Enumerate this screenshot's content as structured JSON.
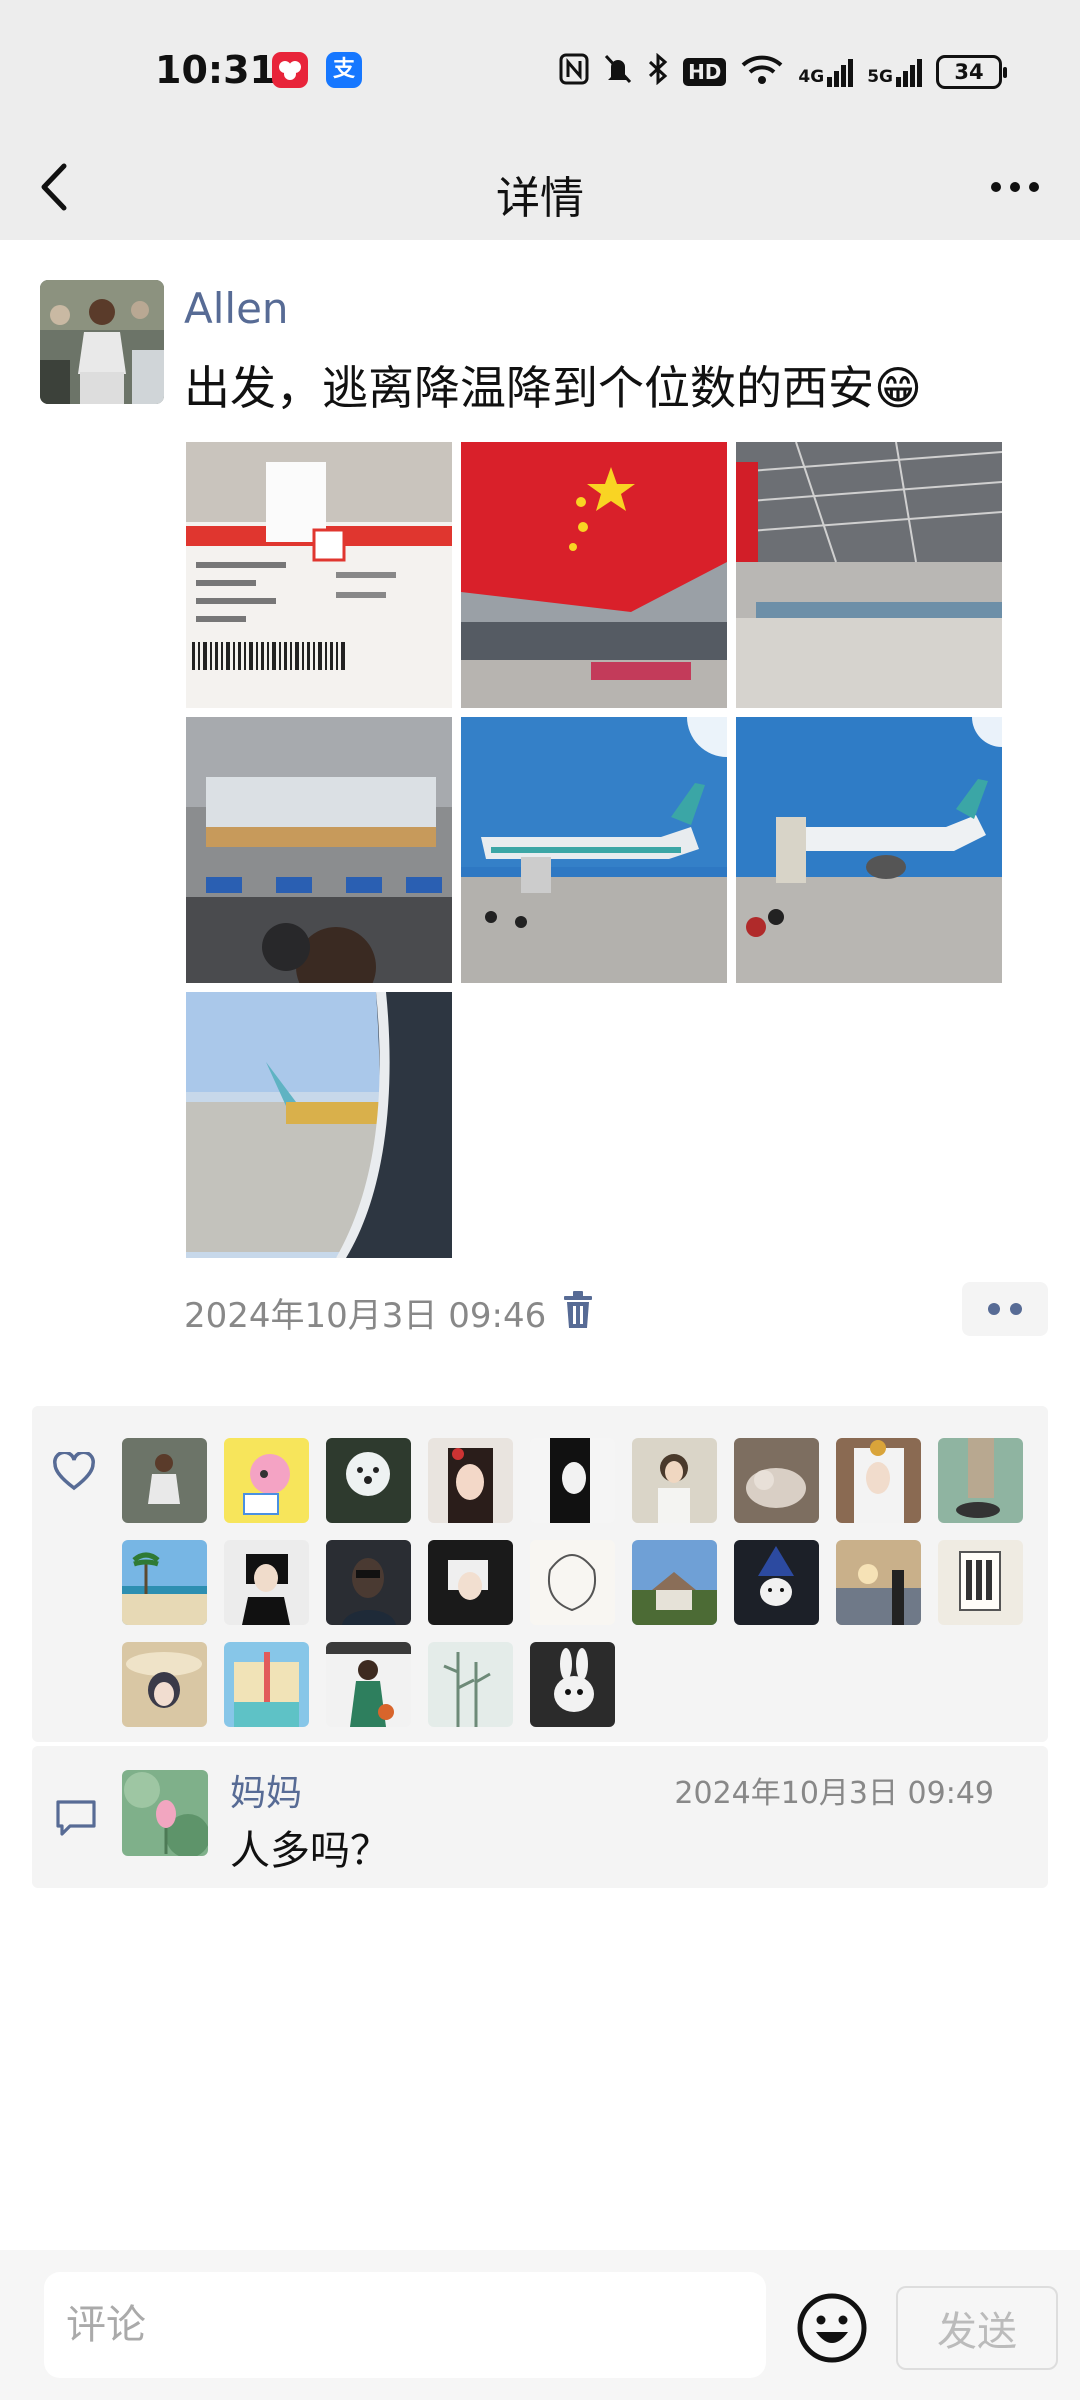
{
  "status_bar": {
    "time": "10:31",
    "apps": [
      {
        "icon": "hearts-app-icon",
        "color": "#e8243a"
      },
      {
        "icon": "alipay-app-icon",
        "color": "#1677ff",
        "glyph": "支"
      }
    ],
    "indicators": [
      "nfc-icon",
      "mute-icon",
      "bluetooth-icon",
      "hd-icon",
      "wifi-icon",
      "4g-signal-icon",
      "5g-signal-icon"
    ],
    "hd_label": "HD",
    "net_4g": "4G",
    "net_5g": "5G",
    "battery": "34"
  },
  "nav": {
    "title": "详情"
  },
  "post": {
    "author": "Allen",
    "text": "出发，逃离降温降到个位数的西安😁",
    "timestamp": "2024年10月3日 09:46",
    "photos": [
      {
        "subject": "boarding-pass-photo"
      },
      {
        "subject": "flag-terminal-photo"
      },
      {
        "subject": "terminal-hall-photo"
      },
      {
        "subject": "check-in-hall-photo"
      },
      {
        "subject": "airplane-tarmac-photo-1"
      },
      {
        "subject": "airplane-tarmac-photo-2"
      },
      {
        "subject": "airplane-window-photo"
      }
    ]
  },
  "likes": {
    "count_avatars": 23
  },
  "comments": [
    {
      "author": "妈妈",
      "time": "2024年10月3日 09:49",
      "text": "人多吗？"
    }
  ],
  "composer": {
    "placeholder": "评论",
    "send_label": "发送"
  },
  "colors": {
    "link": "#576b95",
    "header_bg": "#ededed",
    "panel_bg": "#f4f4f4"
  }
}
